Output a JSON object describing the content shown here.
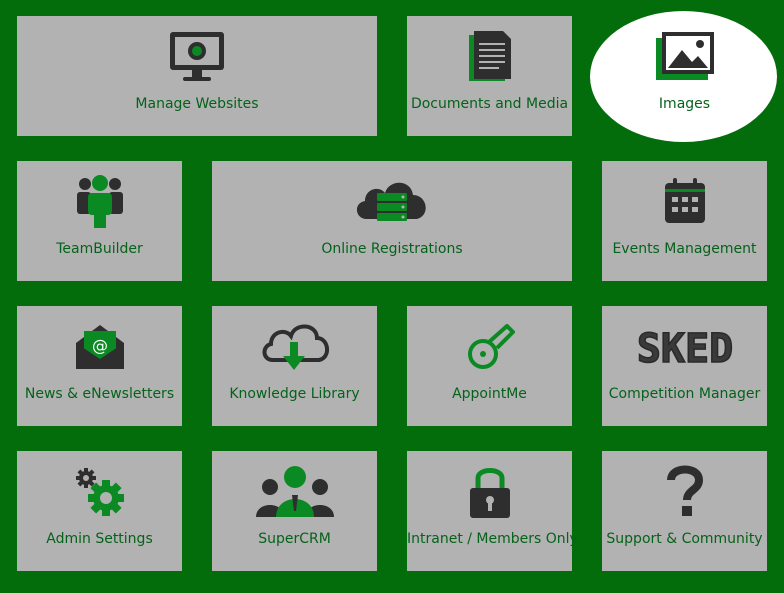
{
  "colors": {
    "background": "#036c0b",
    "tile": "#b2b2b2",
    "label": "#05621a",
    "icon_dark": "#2e2e2e",
    "icon_green": "#0b8a24",
    "highlight": "#ffffff"
  },
  "tiles": [
    {
      "label": "Manage Websites",
      "icon": "monitor-icon"
    },
    {
      "label": "Documents and Media",
      "icon": "document-icon"
    },
    {
      "label": "Images",
      "icon": "image-icon"
    },
    {
      "label": "TeamBuilder",
      "icon": "team-icon"
    },
    {
      "label": "Online Registrations",
      "icon": "cloud-server-icon"
    },
    {
      "label": "Events Management",
      "icon": "calendar-icon"
    },
    {
      "label": "News & eNewsletters",
      "icon": "email-envelope-icon"
    },
    {
      "label": "Knowledge Library",
      "icon": "cloud-download-icon"
    },
    {
      "label": "AppointMe",
      "icon": "whistle-icon"
    },
    {
      "label": "Competition Manager",
      "icon": "sked-logo-icon"
    },
    {
      "label": "Admin Settings",
      "icon": "gears-icon"
    },
    {
      "label": "SuperCRM",
      "icon": "people-group-icon"
    },
    {
      "label": "Intranet / Members Only",
      "icon": "lock-icon"
    },
    {
      "label": "Support & Community",
      "icon": "question-mark-icon"
    }
  ],
  "sked_logo_text": "SKED"
}
